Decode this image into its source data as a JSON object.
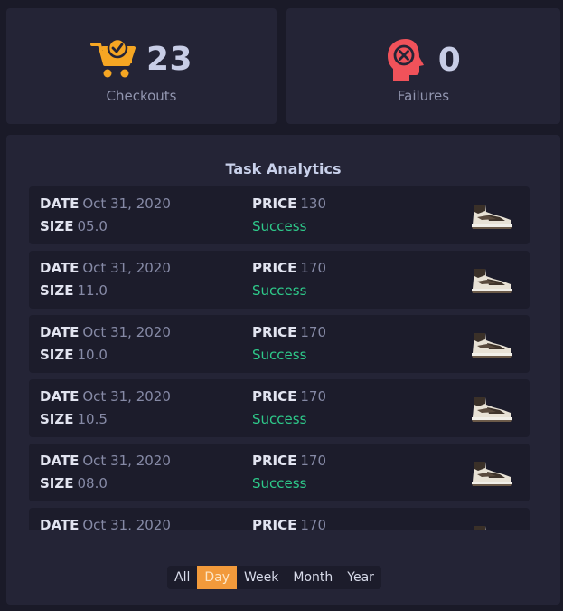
{
  "stats": {
    "checkouts": {
      "value": "23",
      "label": "Checkouts",
      "icon": "cart-check-icon",
      "color": "#f5a623"
    },
    "failures": {
      "value": "0",
      "label": "Failures",
      "icon": "head-x-icon",
      "color": "#f0525a"
    }
  },
  "analytics": {
    "title": "Task Analytics",
    "date_label": "DATE",
    "size_label": "SIZE",
    "price_label": "PRICE",
    "rows": [
      {
        "date": "Oct 31, 2020",
        "size": "05.0",
        "price": "130",
        "status": "Success"
      },
      {
        "date": "Oct 31, 2020",
        "size": "11.0",
        "price": "170",
        "status": "Success"
      },
      {
        "date": "Oct 31, 2020",
        "size": "10.0",
        "price": "170",
        "status": "Success"
      },
      {
        "date": "Oct 31, 2020",
        "size": "10.5",
        "price": "170",
        "status": "Success"
      },
      {
        "date": "Oct 31, 2020",
        "size": "08.0",
        "price": "170",
        "status": "Success"
      },
      {
        "date": "Oct 31, 2020",
        "size": "",
        "price": "170",
        "status": ""
      }
    ]
  },
  "filters": {
    "options": [
      "All",
      "Day",
      "Week",
      "Month",
      "Year"
    ],
    "selected": "Day"
  },
  "colors": {
    "success": "#2ec98a",
    "accent": "#f29a3b"
  }
}
